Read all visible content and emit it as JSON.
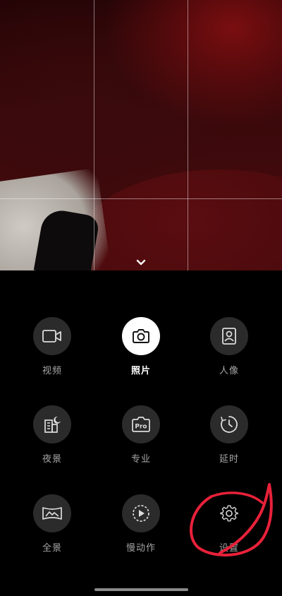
{
  "modes": [
    {
      "id": "video",
      "label": "视频",
      "icon": "video-camera-icon",
      "active": false
    },
    {
      "id": "photo",
      "label": "照片",
      "icon": "camera-icon",
      "active": true
    },
    {
      "id": "portrait",
      "label": "人像",
      "icon": "portrait-icon",
      "active": false
    },
    {
      "id": "night",
      "label": "夜景",
      "icon": "night-city-icon",
      "active": false
    },
    {
      "id": "pro",
      "label": "专业",
      "icon": "pro-camera-icon",
      "active": false,
      "icon_text": "Pro"
    },
    {
      "id": "timelapse",
      "label": "延时",
      "icon": "timelapse-icon",
      "active": false
    },
    {
      "id": "panorama",
      "label": "全景",
      "icon": "panorama-icon",
      "active": false
    },
    {
      "id": "slowmo",
      "label": "慢动作",
      "icon": "slow-motion-icon",
      "active": false
    },
    {
      "id": "settings",
      "label": "设置",
      "icon": "gear-icon",
      "active": false
    }
  ],
  "colors": {
    "background": "#000000",
    "mode_button": "#2b2b2b",
    "active_button": "#ffffff",
    "label": "#a6a6a6",
    "active_label": "#ffffff",
    "annotation": "#e8213a"
  }
}
